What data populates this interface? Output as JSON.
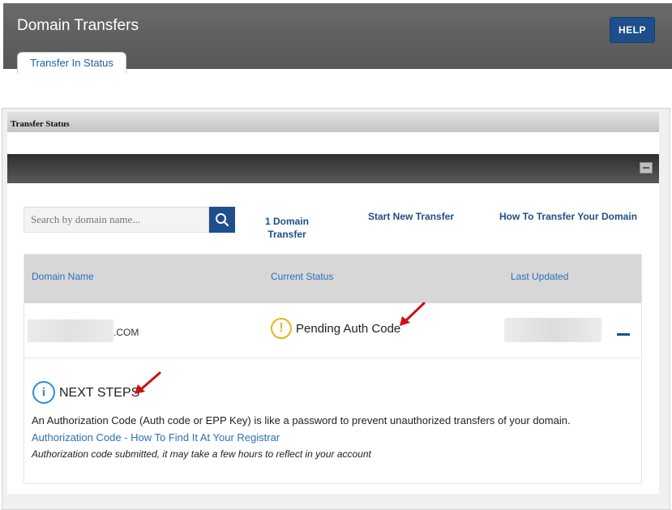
{
  "header": {
    "title": "Domain Transfers",
    "help_label": "HELP",
    "tab_label": "Transfer In Status"
  },
  "panel": {
    "title": "Transfer Status"
  },
  "toolbar": {
    "search_placeholder": "Search by domain name...",
    "search_icon": "search-icon",
    "count_link": "1 Domain Transfer",
    "start_link": "Start New Transfer",
    "how_link": "How To Transfer Your Domain"
  },
  "table": {
    "columns": [
      "Domain Name",
      "Current Status",
      "Last Updated"
    ],
    "rows": [
      {
        "domain_suffix": ".COM",
        "status": "Pending Auth Code"
      }
    ]
  },
  "next_steps": {
    "heading": "NEXT STEPS",
    "description": "An Authorization Code (Auth code or EPP Key) is like a password to prevent unauthorized transfers of your domain.",
    "link": "Authorization Code - How To Find It At Your Registrar",
    "note": "Authorization code submitted, it may take a few hours to reflect in your account"
  },
  "colors": {
    "accent": "#1e4e8c",
    "link": "#2d6fb8",
    "warning": "#e6b31e",
    "info": "#2c8fd6",
    "annotation_arrow": "#cc1111"
  }
}
